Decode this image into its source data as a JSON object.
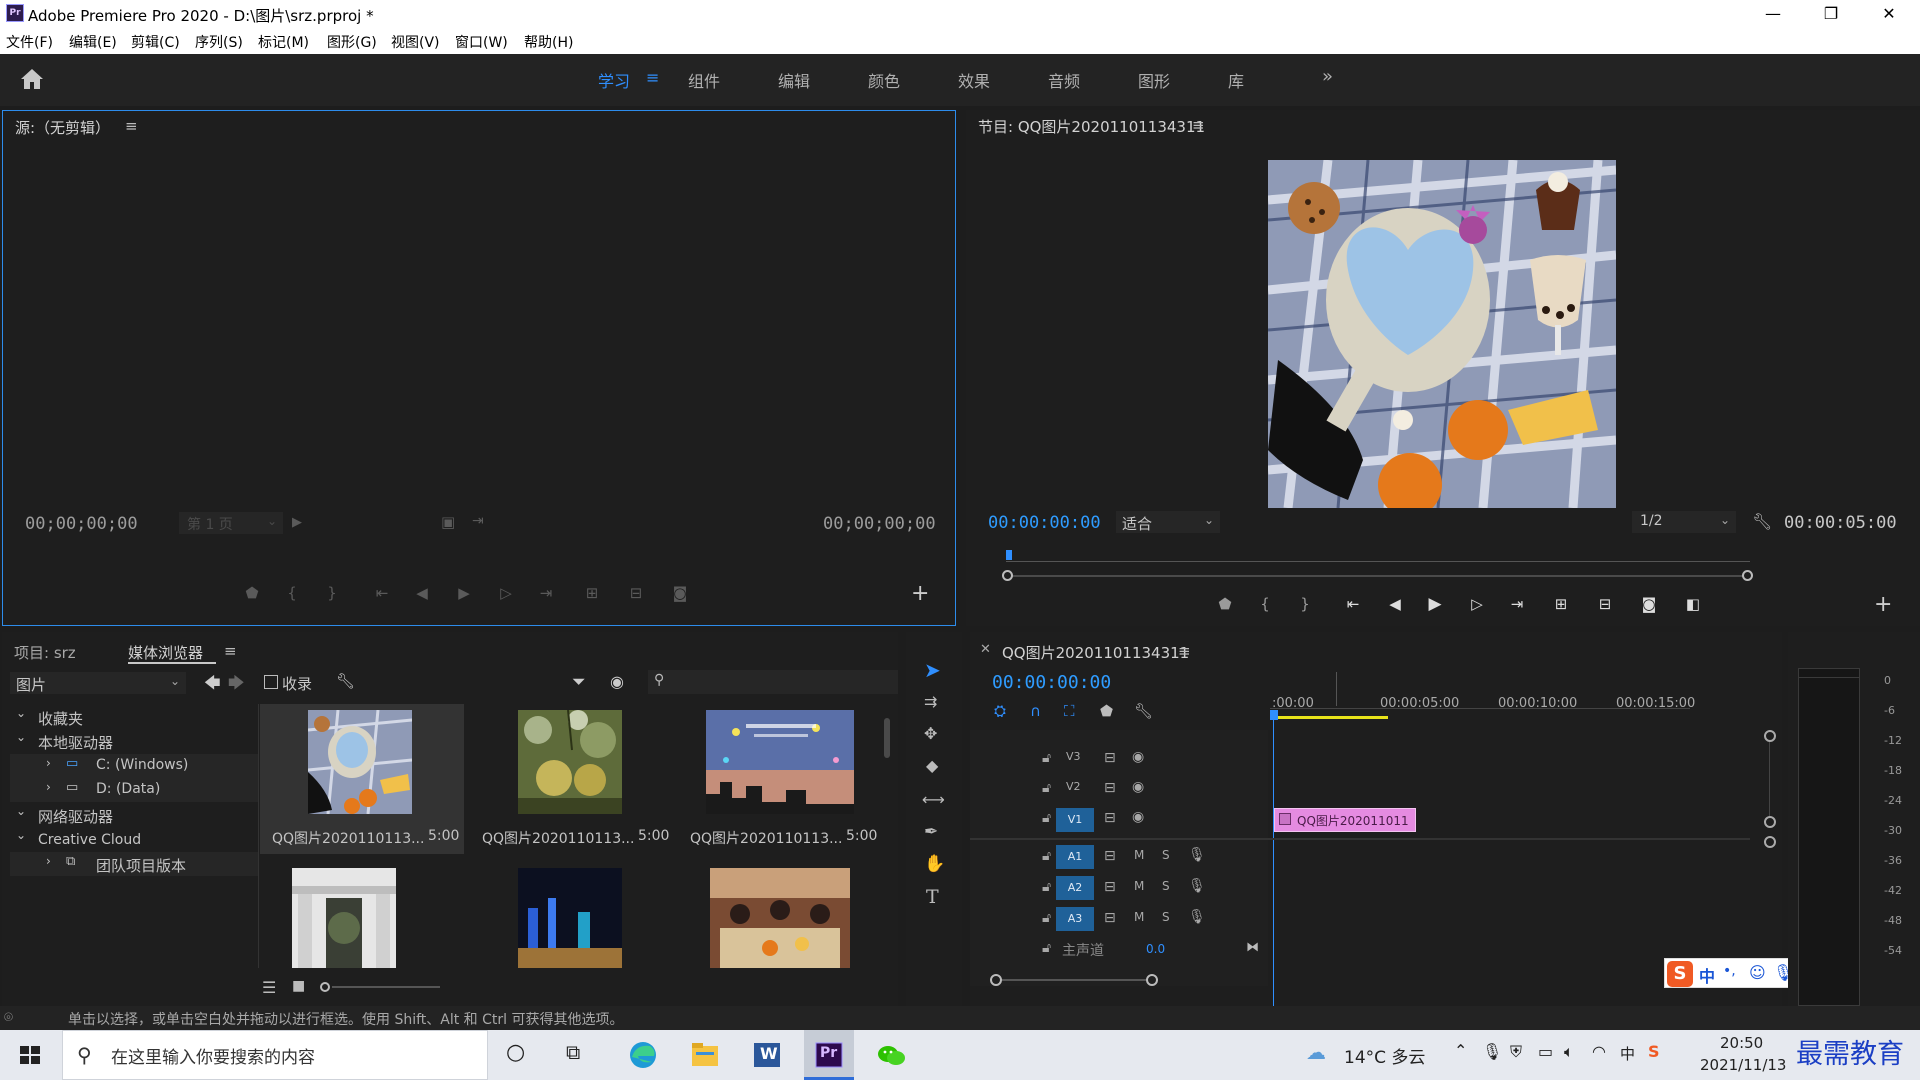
{
  "window": {
    "title": "Adobe Premiere Pro 2020 - D:\\图片\\srz.prproj *",
    "app_icon_text": "Pr",
    "minimize": "—",
    "restore": "❐",
    "close": "✕"
  },
  "menu": [
    "文件(F)",
    "编辑(E)",
    "剪辑(C)",
    "序列(S)",
    "标记(M)",
    "图形(G)",
    "视图(V)",
    "窗口(W)",
    "帮助(H)"
  ],
  "workspaces": {
    "tabs": [
      "学习",
      "组件",
      "编辑",
      "颜色",
      "效果",
      "音频",
      "图形",
      "库"
    ],
    "active_index": 0,
    "overflow": "»"
  },
  "source_monitor": {
    "title": "源:（无剪辑）",
    "timecode_in": "00;00;00;00",
    "timecode_out": "00;00;00;00",
    "page": "第 1 页"
  },
  "program_monitor": {
    "title": "节目: QQ图片20201101134311",
    "timecode": "00:00:00:00",
    "fit": "适合",
    "resolution": "1/2",
    "duration": "00:00:05:00"
  },
  "project_panel": {
    "tab_project": "项目: srz",
    "tab_media_browser": "媒体浏览器",
    "location": "图片",
    "collect_label": "收录",
    "tree": {
      "favorites": "收藏夹",
      "local_drives": "本地驱动器",
      "drive_c": "C: (Windows)",
      "drive_d": "D: (Data)",
      "network_drives": "网络驱动器",
      "creative_cloud": "Creative Cloud",
      "team_projects": "团队项目版本"
    },
    "media": [
      {
        "name": "QQ图片2020110113...",
        "duration": "5:00"
      },
      {
        "name": "QQ图片2020110113...",
        "duration": "5:00"
      },
      {
        "name": "QQ图片2020110113...",
        "duration": "5:00"
      }
    ]
  },
  "timeline": {
    "title": "QQ图片20201101134311",
    "timecode": "00:00:00:00",
    "ruler": [
      ":00:00",
      "00:00:05:00",
      "00:00:10:00",
      "00:00:15:00"
    ],
    "tracks": {
      "video": [
        "V3",
        "V2",
        "V1"
      ],
      "audio": [
        "A1",
        "A2",
        "A3"
      ],
      "mute": "M",
      "solo": "S",
      "master_label": "主声道",
      "master_value": "0.0"
    },
    "clip_label": "QQ图片202011011"
  },
  "audio_meter": {
    "scale": [
      "0",
      "-6",
      "-12",
      "-18",
      "-24",
      "-30",
      "-36",
      "-42",
      "-48",
      "-54"
    ]
  },
  "status_bar": {
    "text": "单击以选择，或单击空白处并拖动以进行框选。使用 Shift、Alt 和 Ctrl 可获得其他选项。"
  },
  "ime_bar": {
    "logo": "S",
    "mode": "中",
    "punct": "•,"
  },
  "taskbar": {
    "search_placeholder": "在这里输入你要搜索的内容",
    "weather": "14°C 多云",
    "time": "20:50",
    "date": "2021/11/13",
    "lang": "中",
    "watermark": "最需教育",
    "word_label": "W",
    "pr_label": "Pr"
  },
  "colors": {
    "accent_blue": "#2f8fff",
    "clip_pink": "#e58be1",
    "track_blue": "#1f6199",
    "panel_bg": "#1e1e1e",
    "workarea_yellow": "#e8e31a"
  }
}
